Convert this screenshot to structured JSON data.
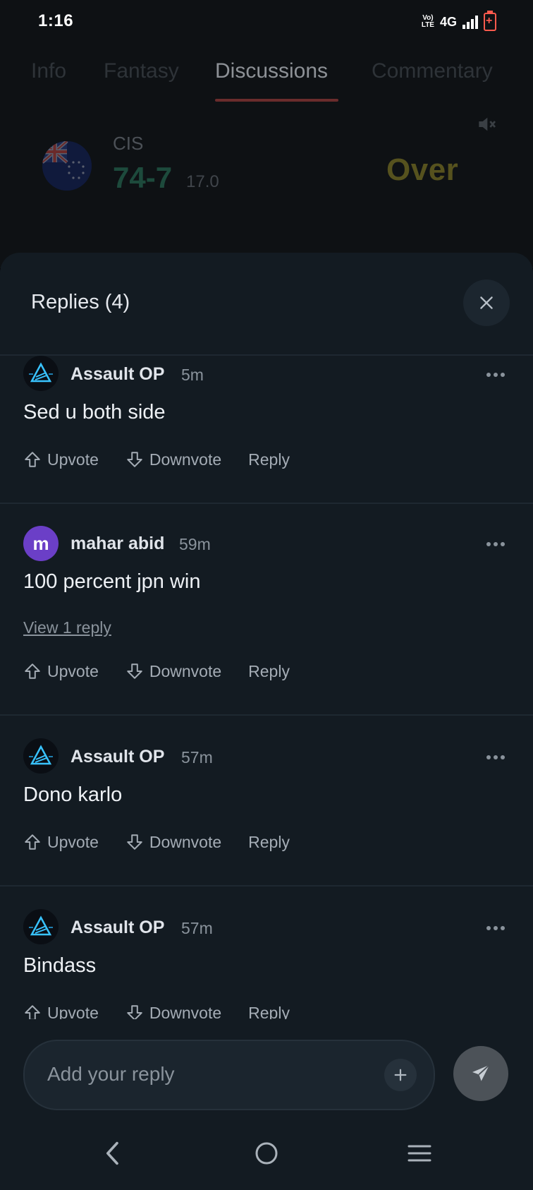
{
  "status_bar": {
    "time": "1:16",
    "volte": "Vo)) LTE",
    "network": "4G"
  },
  "tabs": [
    {
      "label": "Info"
    },
    {
      "label": "Fantasy"
    },
    {
      "label": "Discussions",
      "active": true
    },
    {
      "label": "Commentary"
    }
  ],
  "scorecard": {
    "team": "CIS",
    "score": "74-7",
    "overs": "17.0",
    "status": "Over"
  },
  "sheet": {
    "title": "Replies (4)"
  },
  "comments": [
    {
      "author": "Assault OP",
      "time": "5m",
      "text": "Sed u both side",
      "avatar": "logo"
    },
    {
      "author": "mahar abid",
      "time": "59m",
      "text": "100 percent jpn win",
      "avatar_letter": "m",
      "view_replies": "View 1 reply"
    },
    {
      "author": "Assault OP",
      "time": "57m",
      "text": "Dono karlo",
      "avatar": "logo"
    },
    {
      "author": "Assault OP",
      "time": "57m",
      "text": "Bindass",
      "avatar": "logo"
    }
  ],
  "actions": {
    "upvote": "Upvote",
    "downvote": "Downvote",
    "reply": "Reply"
  },
  "composer": {
    "placeholder": "Add your reply",
    "value": ""
  },
  "icons": {
    "close": "close-icon",
    "more": "more-horizontal-icon",
    "upvote": "arrow-up-icon",
    "downvote": "arrow-down-icon",
    "plus": "plus-icon",
    "send": "send-icon",
    "mute": "volume-mute-icon",
    "back": "back-icon",
    "home": "home-icon",
    "menu": "menu-icon"
  },
  "colors": {
    "sheet_bg": "#131b22",
    "avatar_purple": "#6b3fc7",
    "tab_underline": "#6a2c2c",
    "battery": "#ff5a4d"
  }
}
